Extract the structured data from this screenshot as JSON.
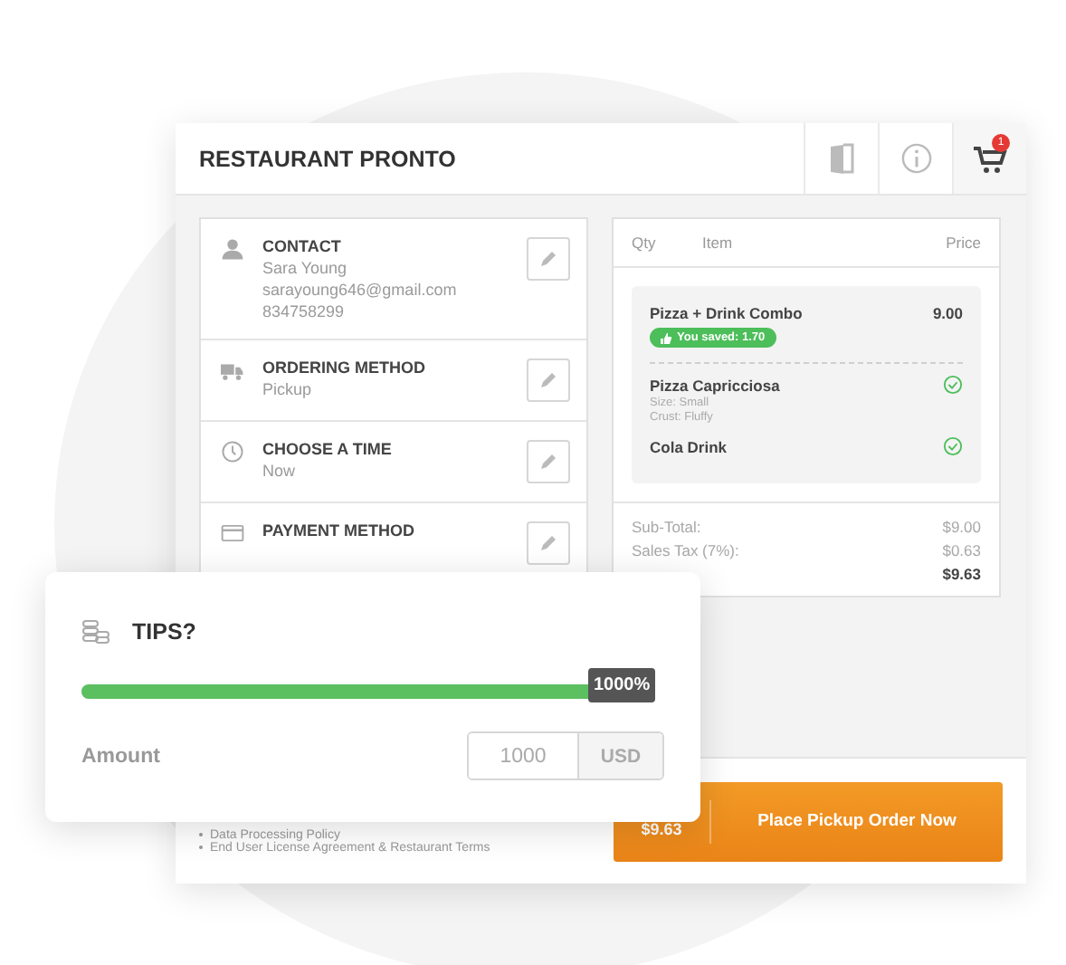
{
  "header": {
    "title": "RESTAURANT PRONTO",
    "cart_badge": "1"
  },
  "checkout_sections": [
    {
      "kind": "contact",
      "title": "CONTACT",
      "lines": [
        "Sara Young",
        "sarayoung646@gmail.com",
        "834758299"
      ]
    },
    {
      "kind": "ordering",
      "title": "ORDERING METHOD",
      "lines": [
        "Pickup"
      ]
    },
    {
      "kind": "time",
      "title": "CHOOSE A TIME",
      "lines": [
        "Now"
      ]
    },
    {
      "kind": "payment",
      "title": "PAYMENT METHOD"
    }
  ],
  "order": {
    "columns": [
      "Qty",
      "Item",
      "Price"
    ],
    "combo": {
      "name": "Pizza + Drink Combo",
      "price": "9.00",
      "saved": "You saved: 1.70"
    },
    "items": [
      {
        "name": "Pizza Capricciosa",
        "details": [
          "Size: Small",
          "Crust: Fluffy"
        ],
        "checked": true
      },
      {
        "name": "Cola Drink",
        "checked": true
      }
    ],
    "totals": [
      {
        "kind": "subtotal",
        "label": "Sub-Total:",
        "value": "$9.00"
      },
      {
        "kind": "subtotal",
        "label": "Sales Tax (7%):",
        "value": "$0.63"
      },
      {
        "kind": "total",
        "value": "$9.63"
      }
    ]
  },
  "legal_links": [
    "Data Processing Policy",
    "End User License Agreement & Restaurant Terms"
  ],
  "place_order": {
    "price": "$9.63",
    "label": "Place Pickup Order Now"
  },
  "tips": {
    "title": "TIPS?",
    "level": 1,
    "reading": "1000%",
    "amount_label": "Amount",
    "amount_value": "1000",
    "currency": "USD"
  }
}
